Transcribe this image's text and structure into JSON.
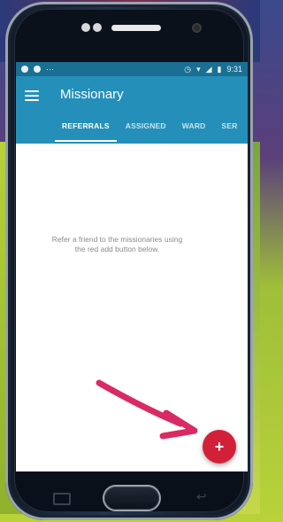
{
  "status_bar": {
    "time": "9:31"
  },
  "app": {
    "title": "Missionary",
    "menu_icon": "hamburger-menu-icon"
  },
  "tabs": [
    {
      "label": "REFERRALS",
      "active": true
    },
    {
      "label": "ASSIGNED",
      "active": false
    },
    {
      "label": "WARD",
      "active": false
    },
    {
      "label": "SER",
      "active": false
    }
  ],
  "main": {
    "empty_message_line1": "Refer a friend to the missionaries using",
    "empty_message_line2": "the red add button below."
  },
  "fab": {
    "label": "+",
    "icon": "add-icon",
    "color": "#d32039"
  },
  "annotation": {
    "arrow_icon": "pointing-arrow-icon",
    "color": "#d92a63"
  },
  "colors": {
    "app_bar": "#2490b9",
    "status_bar": "#1a6f93"
  }
}
